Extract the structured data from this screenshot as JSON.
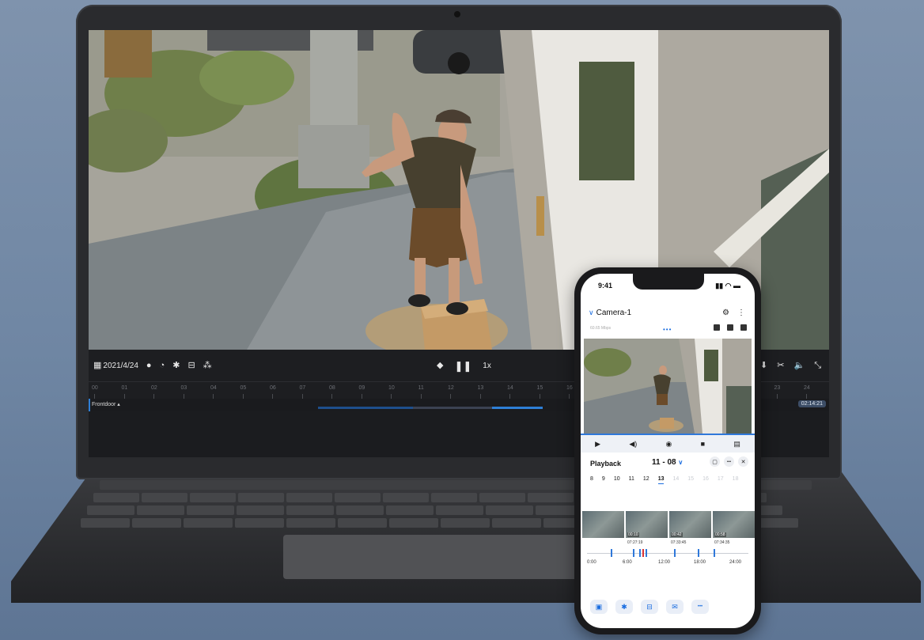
{
  "laptop": {
    "player": {
      "date_label": "2021/4/24",
      "speed": "1x",
      "track_label": "Frontdoor",
      "current_time": "02:14:21",
      "ruler_ticks": [
        "00",
        "01",
        "02",
        "03",
        "04",
        "05",
        "06",
        "07",
        "08",
        "09",
        "10",
        "11",
        "12",
        "13",
        "14",
        "15",
        "16",
        "17",
        "18",
        "19",
        "20",
        "21",
        "22",
        "23",
        "24"
      ]
    }
  },
  "phone": {
    "status_time": "9:41",
    "camera_name": "Camera-1",
    "bitrate": "60.65 Mbps",
    "playback_title": "Playback",
    "playback_date": "11 - 08",
    "days": [
      {
        "label": "8",
        "state": "normal"
      },
      {
        "label": "9",
        "state": "normal"
      },
      {
        "label": "10",
        "state": "normal"
      },
      {
        "label": "11",
        "state": "normal"
      },
      {
        "label": "12",
        "state": "normal"
      },
      {
        "label": "13",
        "state": "active"
      },
      {
        "label": "14",
        "state": "faded"
      },
      {
        "label": "15",
        "state": "faded"
      },
      {
        "label": "16",
        "state": "faded"
      },
      {
        "label": "17",
        "state": "faded"
      },
      {
        "label": "18",
        "state": "faded"
      }
    ],
    "thumbnails": [
      {
        "badge": "",
        "time": ""
      },
      {
        "badge": "00:10",
        "time": "07:27:19"
      },
      {
        "badge": "00:42",
        "time": "07:33:45"
      },
      {
        "badge": "00:58",
        "time": "07:34:35"
      }
    ],
    "timeline_labels": [
      "0:00",
      "6:00",
      "12:00",
      "18:00",
      "24:00"
    ]
  },
  "icons": {
    "play": "▶",
    "pause": "❚❚",
    "volume": "🔈",
    "camera": "📷",
    "record": "■",
    "gear": "⚙",
    "more": "⋮",
    "close": "✕",
    "ellipsis": "•••"
  },
  "colors": {
    "accent": "#1a6de0",
    "player_bg": "#1d1e21",
    "timeline_fill": "#2e7fd6"
  }
}
